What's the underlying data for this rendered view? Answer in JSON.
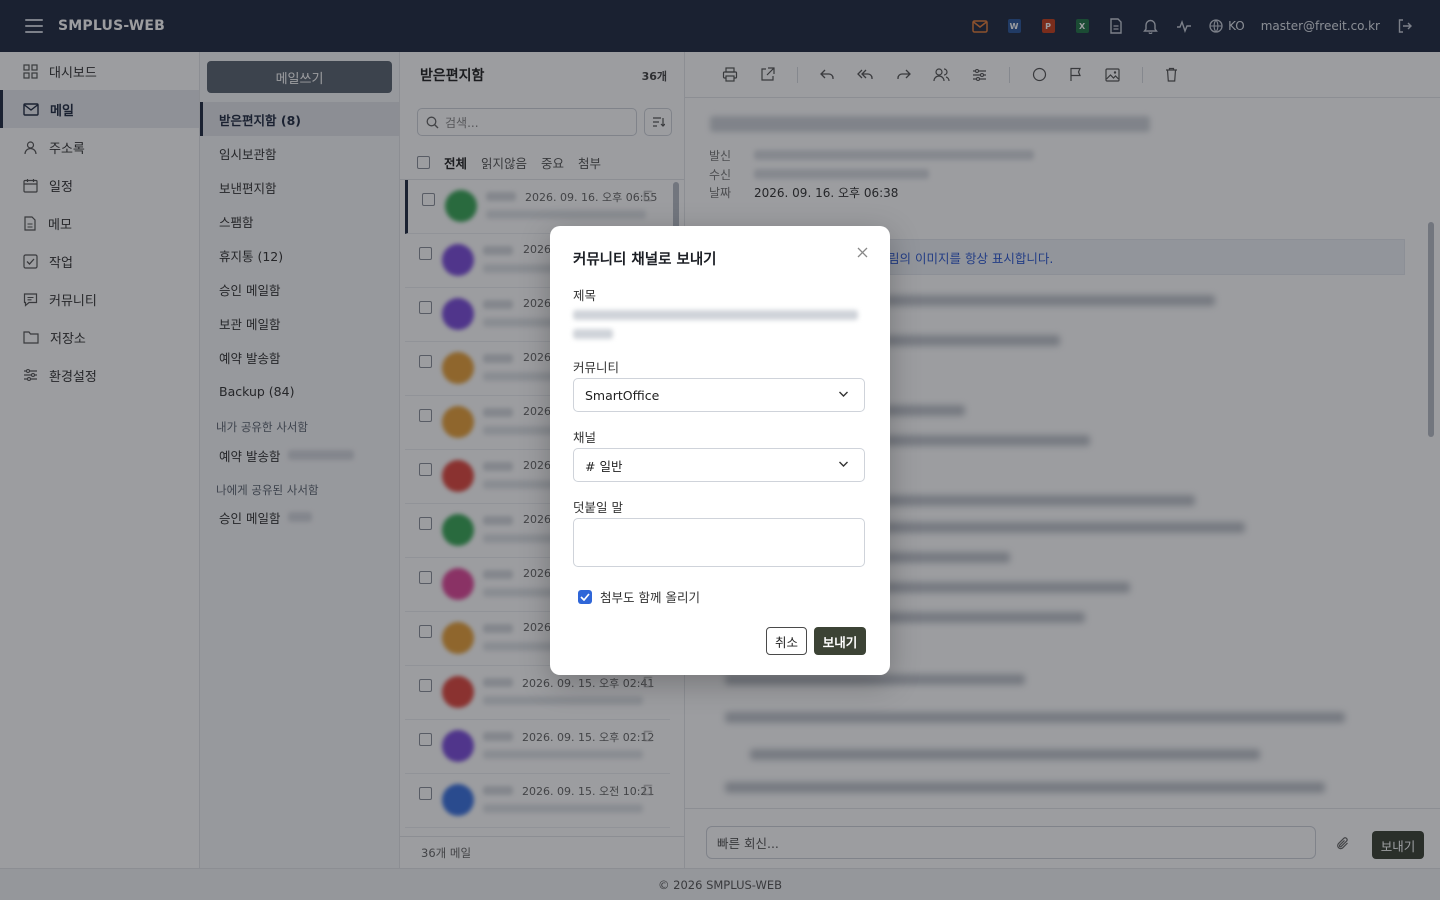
{
  "app": {
    "title": "SMPLUS-WEB",
    "lang": "KO",
    "user": "master@freeit.co.kr",
    "footer": "© 2026 SMPLUS-WEB"
  },
  "sidebar": {
    "items": [
      {
        "label": "대시보드",
        "icon": "dashboard-icon"
      },
      {
        "label": "메일",
        "icon": "mail-icon",
        "active": true
      },
      {
        "label": "주소록",
        "icon": "contacts-icon"
      },
      {
        "label": "일정",
        "icon": "calendar-icon"
      },
      {
        "label": "메모",
        "icon": "memo-icon"
      },
      {
        "label": "작업",
        "icon": "task-icon"
      },
      {
        "label": "커뮤니티",
        "icon": "community-icon"
      },
      {
        "label": "저장소",
        "icon": "folder-icon"
      },
      {
        "label": "환경설정",
        "icon": "settings-icon"
      }
    ]
  },
  "folders": {
    "compose": "메일쓰기",
    "items": [
      "받은편지함 (8)",
      "임시보관함",
      "보낸편지함",
      "스팸함",
      "휴지통 (12)",
      "승인 메일함",
      "보관 메일함",
      "예약 발송함",
      "Backup (84)"
    ],
    "shared_by_me_title": "내가 공유한 사서함",
    "shared_by_me_item": "예약 발송함",
    "shared_to_me_title": "나에게 공유된 사서함",
    "shared_to_me_item": "승인 메일함"
  },
  "list": {
    "title": "받은편지함",
    "count": "36개",
    "search_placeholder": "검색...",
    "tabs": [
      "전체",
      "읽지않음",
      "중요",
      "첨부"
    ],
    "rows": [
      {
        "date": "2026. 09. 16. 오후 06:55",
        "avatar": "#3aa757"
      },
      {
        "date": "2026.",
        "avatar": "#7c4ddb"
      },
      {
        "date": "2026.",
        "avatar": "#7c4ddb"
      },
      {
        "date": "2026.",
        "avatar": "#e8a13a"
      },
      {
        "date": "2026.",
        "avatar": "#e8a13a"
      },
      {
        "date": "2026.",
        "avatar": "#e0483f"
      },
      {
        "date": "2026.",
        "avatar": "#3aa757"
      },
      {
        "date": "2026.",
        "avatar": "#e0489a"
      },
      {
        "date": "2026.",
        "avatar": "#e8a13a"
      },
      {
        "date": "2026. 09. 15. 오후 02:41",
        "avatar": "#e0483f"
      },
      {
        "date": "2026. 09. 15. 오후 02:12",
        "avatar": "#7c4ddb"
      },
      {
        "date": "2026. 09. 15. 오전 10:21",
        "avatar": "#3b72e0"
      }
    ],
    "footer": "36개 메일"
  },
  "reader": {
    "from_label": "발신",
    "to_label": "수신",
    "date_label": "날짜",
    "date": "2026. 09. 16. 오후 06:38",
    "image_notice": "림의 이미지를 항상 표시합니다.",
    "reply_placeholder": "빠른 회신...",
    "send": "보내기"
  },
  "modal": {
    "title": "커뮤니티 채널로 보내기",
    "subject_label": "제목",
    "community_label": "커뮤니티",
    "community_value": "SmartOffice",
    "channel_label": "채널",
    "channel_value": "# 일반",
    "comment_label": "덧붙일 말",
    "comment_value": "",
    "attach_label": "첨부도 함께 올리기",
    "attach_checked": true,
    "cancel": "취소",
    "send": "보내기"
  }
}
